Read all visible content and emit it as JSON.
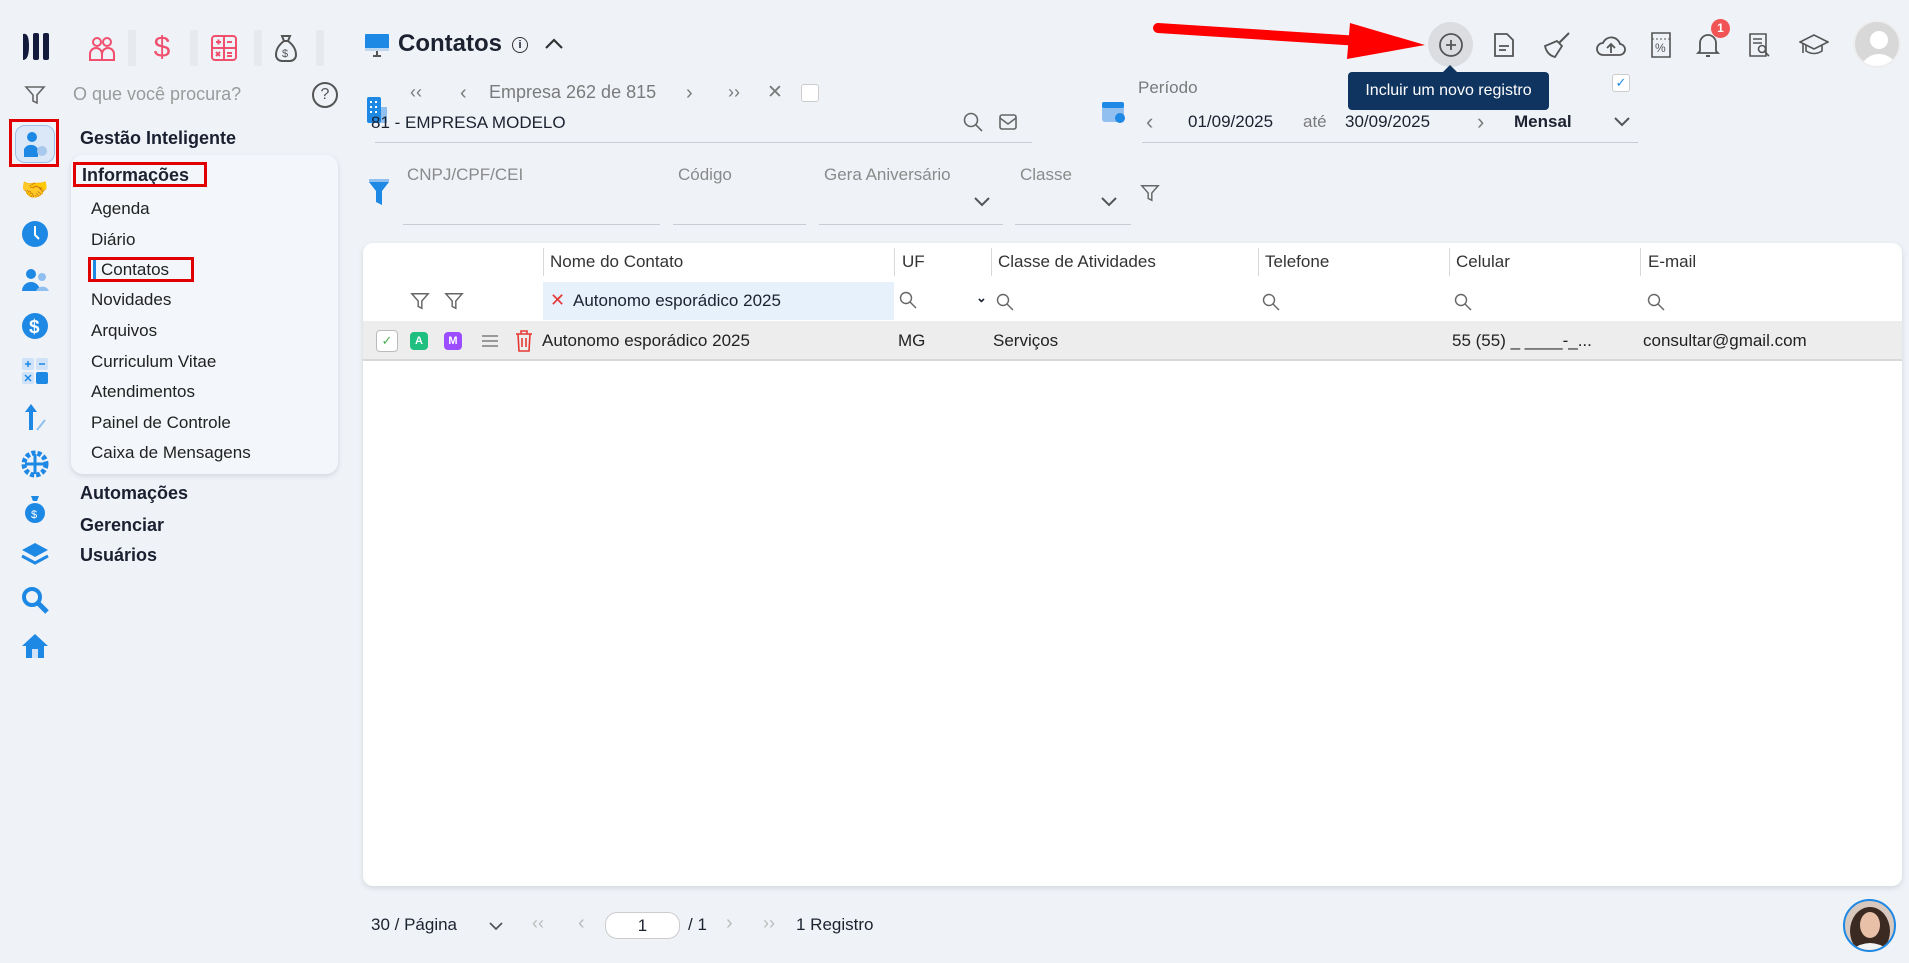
{
  "modules": [
    {
      "icon": "people-icon"
    },
    {
      "icon": "dollar-icon"
    },
    {
      "icon": "calculator-icon"
    },
    {
      "icon": "money-bag-icon"
    }
  ],
  "search": {
    "placeholder": "O que você procura?"
  },
  "menu": {
    "section": "Gestão Inteligente",
    "group": "Informações",
    "items": [
      "Agenda",
      "Diário",
      "Contatos",
      "Novidades",
      "Arquivos",
      "Curriculum Vitae",
      "Atendimentos",
      "Painel de Controle",
      "Caixa de Mensagens"
    ],
    "active": "Contatos",
    "other_groups": [
      "Automações",
      "Gerenciar",
      "Usuários"
    ]
  },
  "header": {
    "title": "Contatos"
  },
  "empresa": {
    "nav_label": "Empresa 262 de 815",
    "value": "81 - EMPRESA MODELO"
  },
  "periodo": {
    "label": "Período",
    "start": "01/09/2025",
    "sep": "até",
    "end": "30/09/2025",
    "mode": "Mensal"
  },
  "filters": {
    "cnpj": "CNPJ/CPF/CEI",
    "codigo": "Código",
    "aniversario": "Gera Aniversário",
    "classe": "Classe"
  },
  "tooltip": "Incluir um novo registro",
  "notifications": {
    "count": "1"
  },
  "table": {
    "columns": [
      "Nome do Contato",
      "UF",
      "Classe de Atividades",
      "Telefone",
      "Celular",
      "E-mail"
    ],
    "filter_value": "Autonomo esporádico 2025",
    "rows": [
      {
        "badge_a": "A",
        "badge_m": "M",
        "name": "Autonomo esporádico 2025",
        "uf": "MG",
        "classe": "Serviços",
        "telefone": "",
        "celular": "55 (55) _ ____-_...",
        "email": "consultar@gmail.com"
      }
    ]
  },
  "pagination": {
    "per_page": "30 / Página",
    "page": "1",
    "total_pages": "/ 1",
    "records": "1 Registro"
  },
  "colors": {
    "accent": "#1e88e5",
    "danger": "#e53935",
    "tooltip": "#0f3460"
  }
}
